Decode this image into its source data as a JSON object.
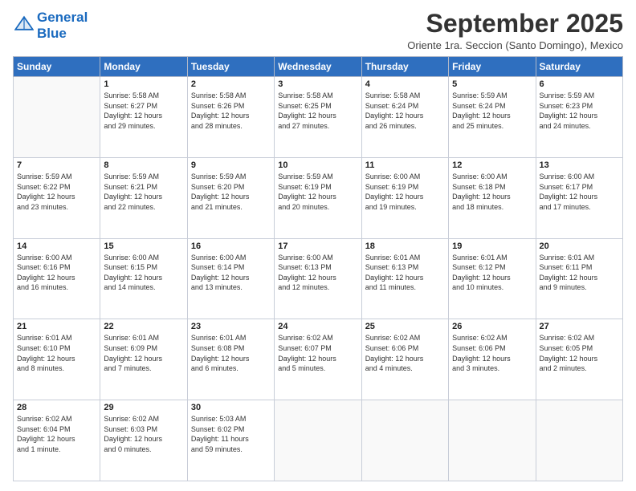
{
  "logo": {
    "line1": "General",
    "line2": "Blue"
  },
  "title": "September 2025",
  "subtitle": "Oriente 1ra. Seccion (Santo Domingo), Mexico",
  "days_header": [
    "Sunday",
    "Monday",
    "Tuesday",
    "Wednesday",
    "Thursday",
    "Friday",
    "Saturday"
  ],
  "weeks": [
    [
      {
        "day": "",
        "info": ""
      },
      {
        "day": "1",
        "info": "Sunrise: 5:58 AM\nSunset: 6:27 PM\nDaylight: 12 hours\nand 29 minutes."
      },
      {
        "day": "2",
        "info": "Sunrise: 5:58 AM\nSunset: 6:26 PM\nDaylight: 12 hours\nand 28 minutes."
      },
      {
        "day": "3",
        "info": "Sunrise: 5:58 AM\nSunset: 6:25 PM\nDaylight: 12 hours\nand 27 minutes."
      },
      {
        "day": "4",
        "info": "Sunrise: 5:58 AM\nSunset: 6:24 PM\nDaylight: 12 hours\nand 26 minutes."
      },
      {
        "day": "5",
        "info": "Sunrise: 5:59 AM\nSunset: 6:24 PM\nDaylight: 12 hours\nand 25 minutes."
      },
      {
        "day": "6",
        "info": "Sunrise: 5:59 AM\nSunset: 6:23 PM\nDaylight: 12 hours\nand 24 minutes."
      }
    ],
    [
      {
        "day": "7",
        "info": "Sunrise: 5:59 AM\nSunset: 6:22 PM\nDaylight: 12 hours\nand 23 minutes."
      },
      {
        "day": "8",
        "info": "Sunrise: 5:59 AM\nSunset: 6:21 PM\nDaylight: 12 hours\nand 22 minutes."
      },
      {
        "day": "9",
        "info": "Sunrise: 5:59 AM\nSunset: 6:20 PM\nDaylight: 12 hours\nand 21 minutes."
      },
      {
        "day": "10",
        "info": "Sunrise: 5:59 AM\nSunset: 6:19 PM\nDaylight: 12 hours\nand 20 minutes."
      },
      {
        "day": "11",
        "info": "Sunrise: 6:00 AM\nSunset: 6:19 PM\nDaylight: 12 hours\nand 19 minutes."
      },
      {
        "day": "12",
        "info": "Sunrise: 6:00 AM\nSunset: 6:18 PM\nDaylight: 12 hours\nand 18 minutes."
      },
      {
        "day": "13",
        "info": "Sunrise: 6:00 AM\nSunset: 6:17 PM\nDaylight: 12 hours\nand 17 minutes."
      }
    ],
    [
      {
        "day": "14",
        "info": "Sunrise: 6:00 AM\nSunset: 6:16 PM\nDaylight: 12 hours\nand 16 minutes."
      },
      {
        "day": "15",
        "info": "Sunrise: 6:00 AM\nSunset: 6:15 PM\nDaylight: 12 hours\nand 14 minutes."
      },
      {
        "day": "16",
        "info": "Sunrise: 6:00 AM\nSunset: 6:14 PM\nDaylight: 12 hours\nand 13 minutes."
      },
      {
        "day": "17",
        "info": "Sunrise: 6:00 AM\nSunset: 6:13 PM\nDaylight: 12 hours\nand 12 minutes."
      },
      {
        "day": "18",
        "info": "Sunrise: 6:01 AM\nSunset: 6:13 PM\nDaylight: 12 hours\nand 11 minutes."
      },
      {
        "day": "19",
        "info": "Sunrise: 6:01 AM\nSunset: 6:12 PM\nDaylight: 12 hours\nand 10 minutes."
      },
      {
        "day": "20",
        "info": "Sunrise: 6:01 AM\nSunset: 6:11 PM\nDaylight: 12 hours\nand 9 minutes."
      }
    ],
    [
      {
        "day": "21",
        "info": "Sunrise: 6:01 AM\nSunset: 6:10 PM\nDaylight: 12 hours\nand 8 minutes."
      },
      {
        "day": "22",
        "info": "Sunrise: 6:01 AM\nSunset: 6:09 PM\nDaylight: 12 hours\nand 7 minutes."
      },
      {
        "day": "23",
        "info": "Sunrise: 6:01 AM\nSunset: 6:08 PM\nDaylight: 12 hours\nand 6 minutes."
      },
      {
        "day": "24",
        "info": "Sunrise: 6:02 AM\nSunset: 6:07 PM\nDaylight: 12 hours\nand 5 minutes."
      },
      {
        "day": "25",
        "info": "Sunrise: 6:02 AM\nSunset: 6:06 PM\nDaylight: 12 hours\nand 4 minutes."
      },
      {
        "day": "26",
        "info": "Sunrise: 6:02 AM\nSunset: 6:06 PM\nDaylight: 12 hours\nand 3 minutes."
      },
      {
        "day": "27",
        "info": "Sunrise: 6:02 AM\nSunset: 6:05 PM\nDaylight: 12 hours\nand 2 minutes."
      }
    ],
    [
      {
        "day": "28",
        "info": "Sunrise: 6:02 AM\nSunset: 6:04 PM\nDaylight: 12 hours\nand 1 minute."
      },
      {
        "day": "29",
        "info": "Sunrise: 6:02 AM\nSunset: 6:03 PM\nDaylight: 12 hours\nand 0 minutes."
      },
      {
        "day": "30",
        "info": "Sunrise: 5:03 AM\nSunset: 6:02 PM\nDaylight: 11 hours\nand 59 minutes."
      },
      {
        "day": "",
        "info": ""
      },
      {
        "day": "",
        "info": ""
      },
      {
        "day": "",
        "info": ""
      },
      {
        "day": "",
        "info": ""
      }
    ]
  ]
}
